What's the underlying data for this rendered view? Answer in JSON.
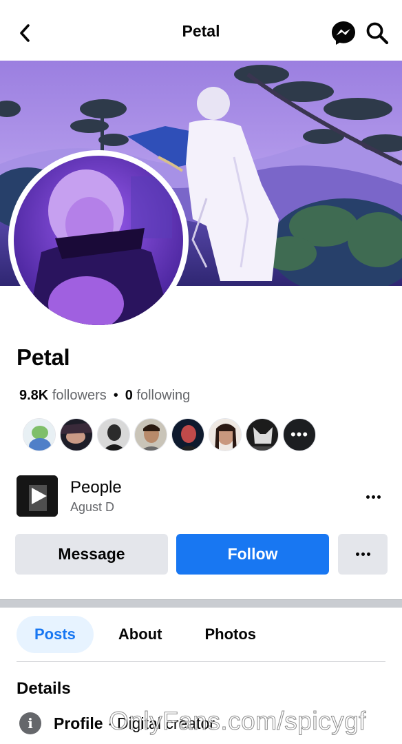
{
  "header": {
    "title": "Petal",
    "back_icon": "chevron-left-icon",
    "messenger_icon": "messenger-icon",
    "search_icon": "search-icon"
  },
  "profile": {
    "name": "Petal",
    "followers_count": "9.8K",
    "followers_label": "followers",
    "following_count": "0",
    "following_label": "following",
    "followers_more_icon": "more-dots-icon"
  },
  "featured": {
    "title": "People",
    "subtitle": "Agust D",
    "thumb_icon": "play-icon"
  },
  "actions": {
    "message_label": "Message",
    "follow_label": "Follow",
    "follow_color": "#1877f2"
  },
  "tabs": [
    {
      "label": "Posts",
      "active": true
    },
    {
      "label": "About",
      "active": false
    },
    {
      "label": "Photos",
      "active": false
    }
  ],
  "details": {
    "heading": "Details",
    "profile_label": "Profile",
    "profile_separator": " · ",
    "profile_value": "Digital creator"
  },
  "watermark": "OnlyFans.com/spicygf"
}
